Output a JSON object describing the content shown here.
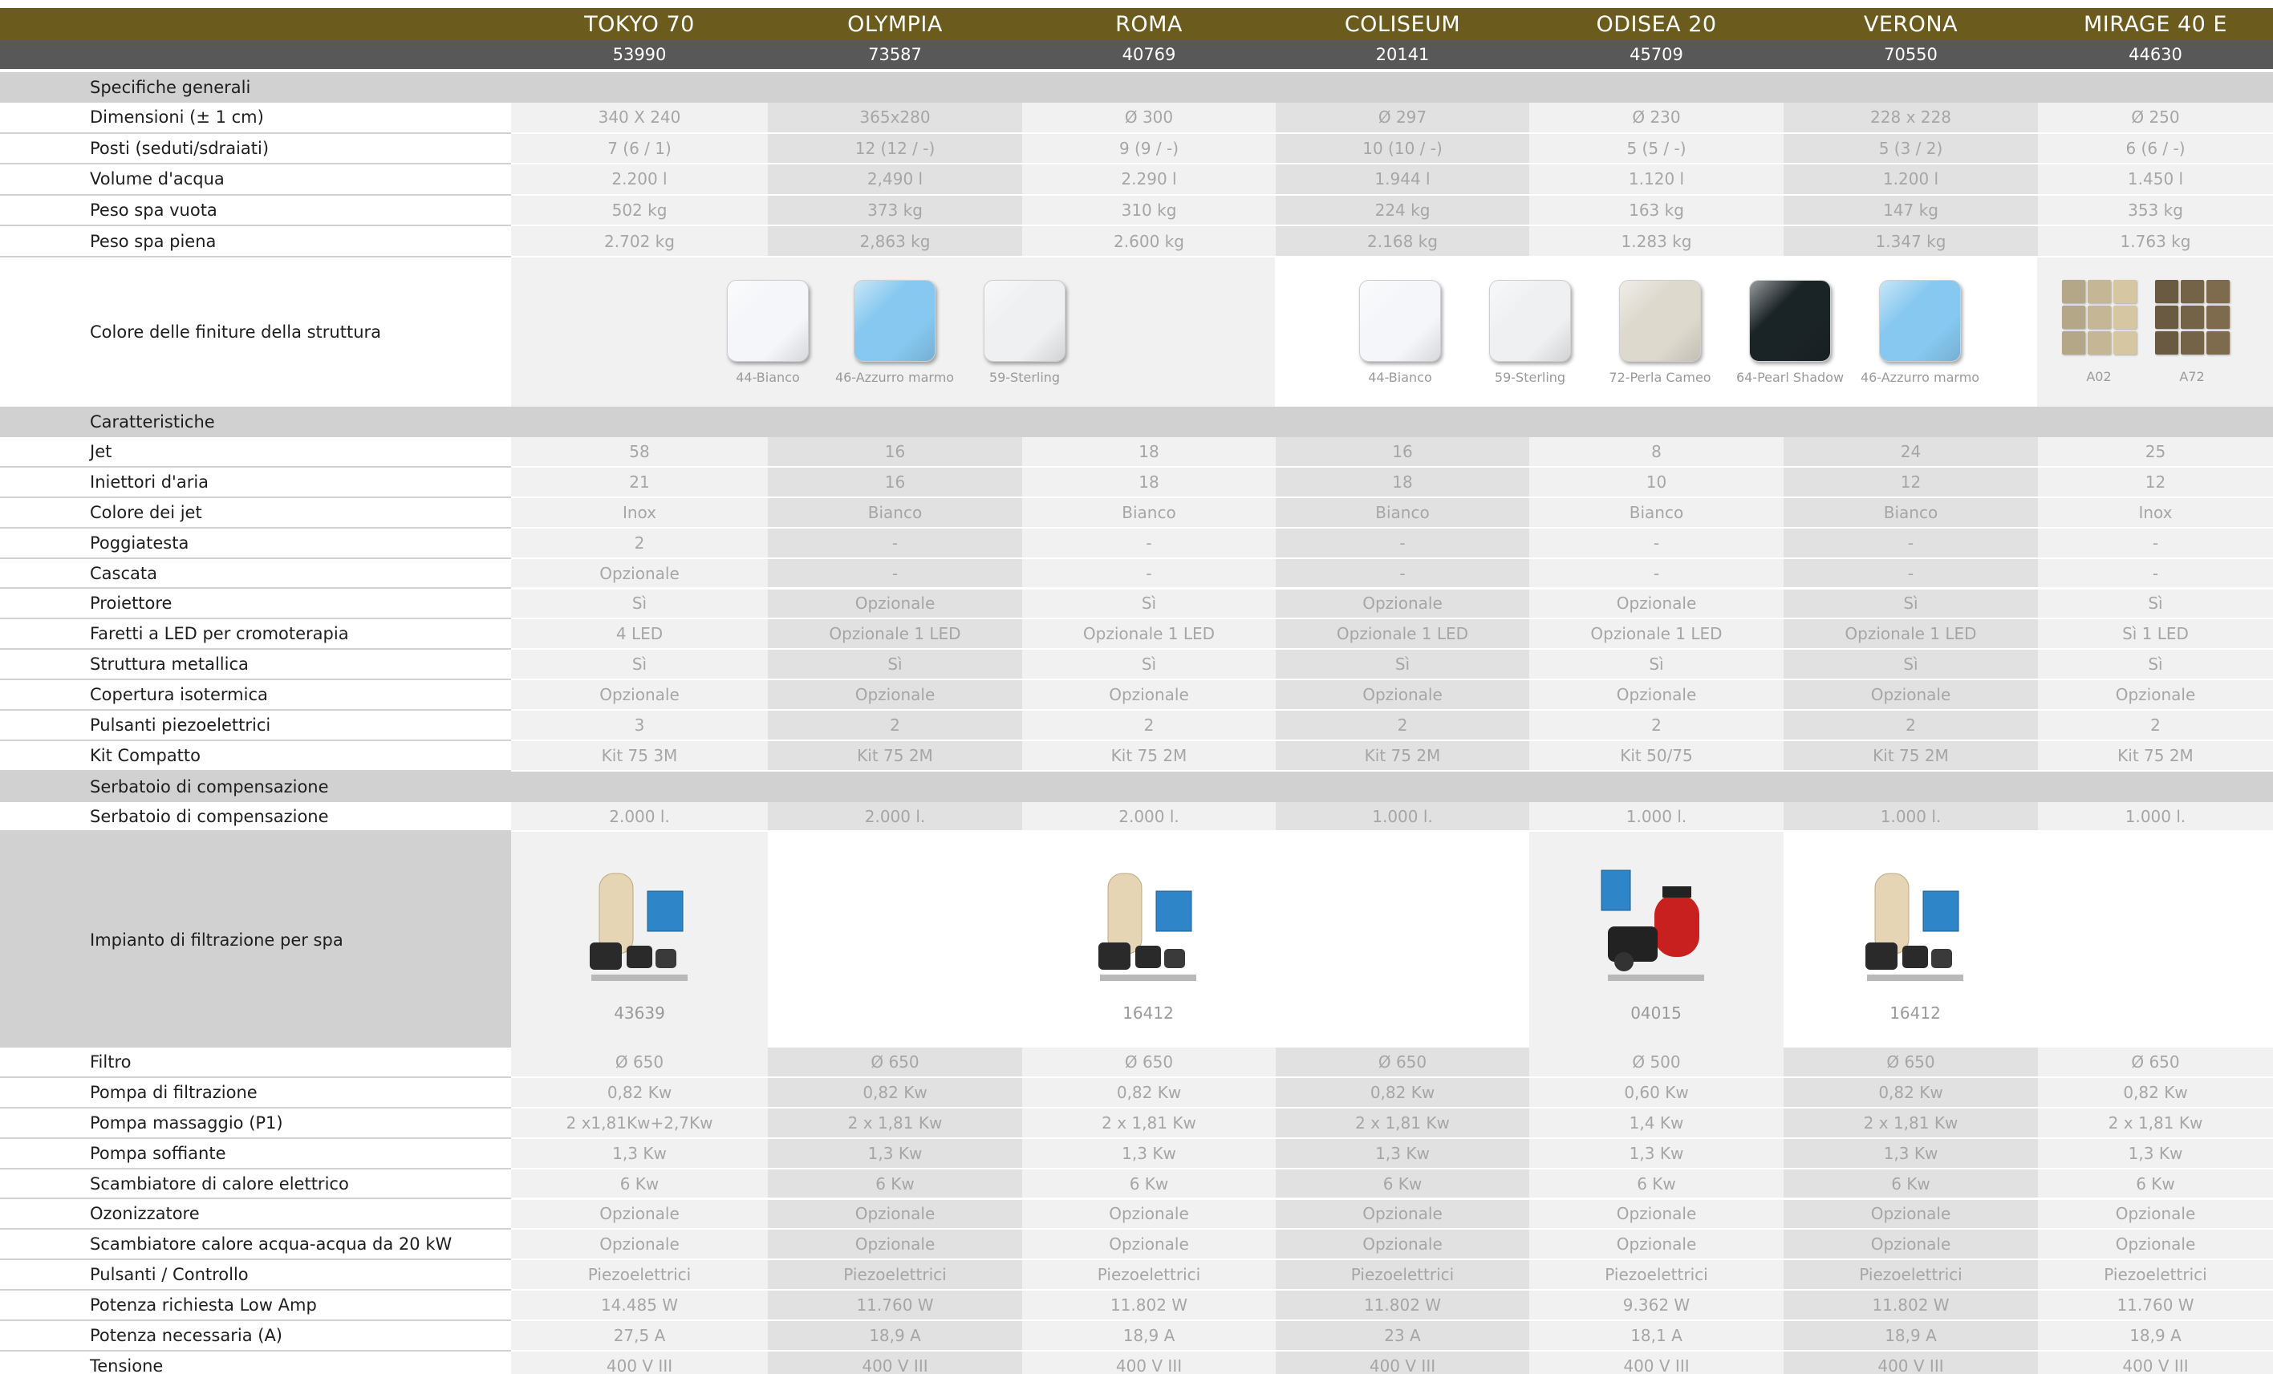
{
  "models": [
    {
      "name": "TOKYO 70",
      "code": "53990"
    },
    {
      "name": "OLYMPIA",
      "code": "73587"
    },
    {
      "name": "ROMA",
      "code": "40769"
    },
    {
      "name": "COLISEUM",
      "code": "20141"
    },
    {
      "name": "ODISEA 20",
      "code": "45709"
    },
    {
      "name": "VERONA",
      "code": "70550"
    },
    {
      "name": "MIRAGE 40 E",
      "code": "44630"
    }
  ],
  "sections": {
    "general": "Specifiche generali",
    "features": "Caratteristiche",
    "tank": "Serbatoio di compensazione"
  },
  "general_rows": [
    {
      "label": "Dimensioni (± 1 cm)",
      "values": [
        "340 X 240",
        "365x280",
        "Ø 300",
        "Ø 297",
        "Ø 230",
        "228 x 228",
        "Ø 250"
      ]
    },
    {
      "label": "Posti (seduti/sdraiati)",
      "values": [
        "7 (6 / 1)",
        "12 (12 / -)",
        "9 (9 / -)",
        "10 (10 / -)",
        "5 (5 / -)",
        "5 (3 / 2)",
        "6 (6 / -)"
      ]
    },
    {
      "label": "Volume d'acqua",
      "values": [
        "2.200 l",
        "2,490 l",
        "2.290 l",
        "1.944 l",
        "1.120 l",
        "1.200 l",
        "1.450 l"
      ]
    },
    {
      "label": "Peso spa vuota",
      "values": [
        "502 kg",
        "373 kg",
        "310 kg",
        "224 kg",
        "163 kg",
        "147 kg",
        "353 kg"
      ]
    },
    {
      "label": "Peso spa piena",
      "values": [
        "2.702 kg",
        "2,863 kg",
        "2.600 kg",
        "2.168 kg",
        "1.283 kg",
        "1.347 kg",
        "1.763 kg"
      ]
    }
  ],
  "finishes": {
    "label": "Colore delle finiture della struttura",
    "group1": [
      {
        "name": "44-Bianco",
        "color": "#f4f6f9"
      },
      {
        "name": "46-Azzurro marmo",
        "color": "#86c8ef"
      },
      {
        "name": "59-Sterling",
        "color": "#eef0f2"
      }
    ],
    "group2": [
      {
        "name": "44-Bianco",
        "color": "#f4f6f9"
      },
      {
        "name": "59-Sterling",
        "color": "#eef0f2"
      },
      {
        "name": "72-Perla Cameo",
        "color": "#ddd9cd"
      },
      {
        "name": "64-Pearl Shadow",
        "color": "#1a2326"
      },
      {
        "name": "46-Azzurro marmo",
        "color": "#86c8ef"
      }
    ],
    "group3": [
      {
        "name": "A02",
        "color": "#d4c4a0"
      },
      {
        "name": "A72",
        "color": "#7d6a4c"
      }
    ]
  },
  "feature_rows": [
    {
      "label": "Jet",
      "values": [
        "58",
        "16",
        "18",
        "16",
        "8",
        "24",
        "25"
      ]
    },
    {
      "label": "Iniettori d'aria",
      "values": [
        "21",
        "16",
        "18",
        "18",
        "10",
        "12",
        "12"
      ]
    },
    {
      "label": "Colore dei jet",
      "values": [
        "Inox",
        "Bianco",
        "Bianco",
        "Bianco",
        "Bianco",
        "Bianco",
        "Inox"
      ]
    },
    {
      "label": "Poggiatesta",
      "values": [
        "2",
        "-",
        "-",
        "-",
        "-",
        "-",
        "-"
      ]
    },
    {
      "label": "Cascata",
      "values": [
        "Opzionale",
        "-",
        "-",
        "-",
        "-",
        "-",
        "-"
      ]
    },
    {
      "label": "Proiettore",
      "values": [
        "Sì",
        "Opzionale",
        "Sì",
        "Opzionale",
        "Opzionale",
        "Sì",
        "Sì"
      ]
    },
    {
      "label": "Faretti a LED per cromoterapia",
      "values": [
        "4 LED",
        "Opzionale 1 LED",
        "Opzionale 1 LED",
        "Opzionale 1 LED",
        "Opzionale 1 LED",
        "Opzionale 1 LED",
        "Sì 1 LED"
      ]
    },
    {
      "label": "Struttura metallica",
      "values": [
        "Sì",
        "Sì",
        "Sì",
        "Sì",
        "Sì",
        "Sì",
        "Sì"
      ]
    },
    {
      "label": "Copertura isotermica",
      "values": [
        "Opzionale",
        "Opzionale",
        "Opzionale",
        "Opzionale",
        "Opzionale",
        "Opzionale",
        "Opzionale"
      ]
    },
    {
      "label": "Pulsanti piezoelettrici",
      "values": [
        "3",
        "2",
        "2",
        "2",
        "2",
        "2",
        "2"
      ]
    },
    {
      "label": "Kit Compatto",
      "values": [
        "Kit 75 3M",
        "Kit 75 2M",
        "Kit 75 2M",
        "Kit 75 2M",
        "Kit 50/75",
        "Kit 75 2M",
        "Kit 75 2M"
      ]
    }
  ],
  "tank_rows": [
    {
      "label": "Serbatoio di compensazione",
      "values": [
        "2.000 l.",
        "2.000 l.",
        "2.000 l.",
        "1.000 l.",
        "1.000 l.",
        "1.000 l.",
        "1.000 l."
      ]
    }
  ],
  "filtration": {
    "label": "Impianto di filtrazione per spa",
    "codes": [
      "43639",
      "16412",
      "04015",
      "16412"
    ]
  },
  "equipment_rows": [
    {
      "label": "Filtro",
      "values": [
        "Ø 650",
        "Ø 650",
        "Ø 650",
        "Ø 650",
        "Ø 500",
        "Ø 650",
        "Ø 650"
      ]
    },
    {
      "label": "Pompa di filtrazione",
      "values": [
        "0,82 Kw",
        "0,82 Kw",
        "0,82 Kw",
        "0,82 Kw",
        "0,60 Kw",
        "0,82 Kw",
        "0,82 Kw"
      ]
    },
    {
      "label": "Pompa massaggio (P1)",
      "values": [
        "2 x1,81Kw+2,7Kw",
        "2 x 1,81 Kw",
        "2 x 1,81 Kw",
        "2 x 1,81 Kw",
        "1,4 Kw",
        "2 x 1,81 Kw",
        "2 x 1,81 Kw"
      ]
    },
    {
      "label": "Pompa soffiante",
      "values": [
        "1,3 Kw",
        "1,3 Kw",
        "1,3 Kw",
        "1,3 Kw",
        "1,3 Kw",
        "1,3 Kw",
        "1,3 Kw"
      ]
    },
    {
      "label": "Scambiatore di calore elettrico",
      "values": [
        "6 Kw",
        "6 Kw",
        "6 Kw",
        "6 Kw",
        "6 Kw",
        "6 Kw",
        "6 Kw"
      ]
    },
    {
      "label": "Ozonizzatore",
      "values": [
        "Opzionale",
        "Opzionale",
        "Opzionale",
        "Opzionale",
        "Opzionale",
        "Opzionale",
        "Opzionale"
      ]
    },
    {
      "label": "Scambiatore calore acqua-acqua da 20 kW",
      "values": [
        "Opzionale",
        "Opzionale",
        "Opzionale",
        "Opzionale",
        "Opzionale",
        "Opzionale",
        "Opzionale"
      ]
    },
    {
      "label": "Pulsanti / Controllo",
      "values": [
        "Piezoelettrici",
        "Piezoelettrici",
        "Piezoelettrici",
        "Piezoelettrici",
        "Piezoelettrici",
        "Piezoelettrici",
        "Piezoelettrici"
      ]
    },
    {
      "label": "Potenza richiesta Low Amp",
      "values": [
        "14.485 W",
        "11.760 W",
        "11.802 W",
        "11.802 W",
        "9.362 W",
        "11.802 W",
        "11.760 W"
      ]
    },
    {
      "label": "Potenza necessaria (A)",
      "values": [
        "27,5 A",
        "18,9 A",
        "18,9 A",
        "23 A",
        "18,1 A",
        "18,9 A",
        "18,9 A"
      ]
    },
    {
      "label": "Tensione",
      "values": [
        "400 V III",
        "400 V III",
        "400 V III",
        "400 V III",
        "400 V III",
        "400 V III",
        "400 V III"
      ]
    }
  ]
}
